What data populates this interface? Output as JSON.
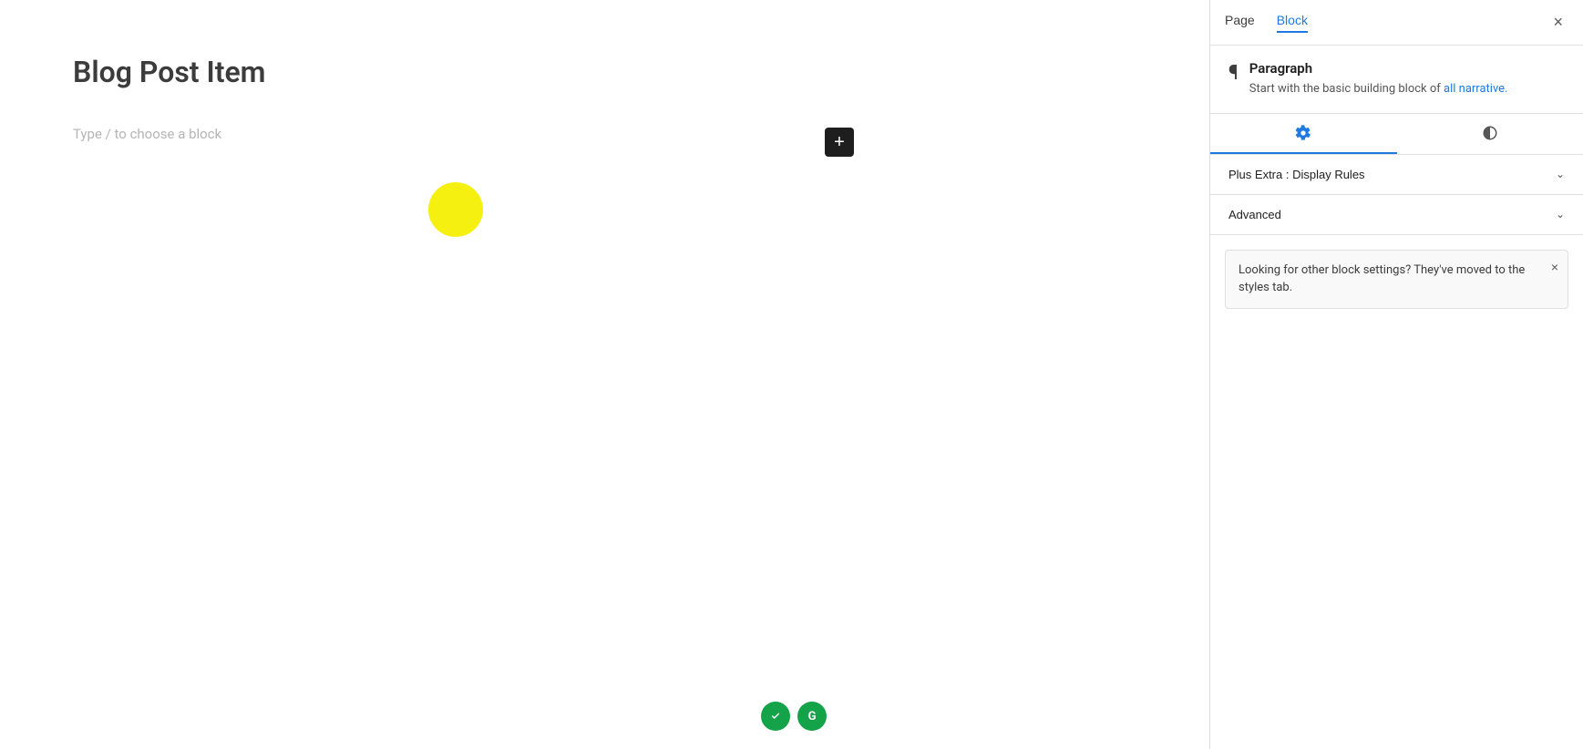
{
  "editor": {
    "title": "Blog Post Item",
    "placeholder": "Type / to choose a block",
    "add_block_label": "+"
  },
  "sidebar": {
    "tab_page": "Page",
    "tab_block": "Block",
    "active_tab": "Block",
    "close_label": "×",
    "block_name": "Paragraph",
    "block_description_part1": "Start with the basic building block of",
    "block_description_part2": "all narrative.",
    "section_plus_display_rules": "Plus Extra : Display Rules",
    "section_advanced": "Advanced",
    "notice_text": "Looking for other block settings? They've moved to the styles tab.",
    "notice_close": "×"
  }
}
